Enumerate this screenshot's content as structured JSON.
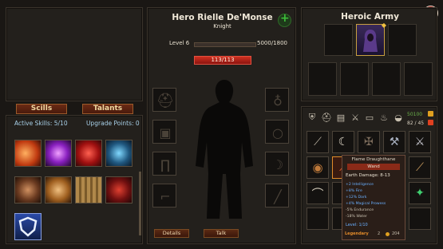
{
  "hero": {
    "name": "Hero Rielle De'Monse",
    "class": "Knight",
    "level_label": "Level 6",
    "xp_text": "5000/1800",
    "hp_text": "113/113"
  },
  "skills_panel": {
    "tab_skills": "Scills",
    "tab_talents": "Talants",
    "active_skills": "Active Skills: 5/10",
    "upgrade_points": "Upgrade Points: 0"
  },
  "center_buttons": {
    "details": "Details",
    "talk": "Talk"
  },
  "army": {
    "title": "Heroic Army"
  },
  "inventory": {
    "gold": "50100",
    "gems": "82 / 45"
  },
  "tooltip": {
    "name": "Flame Draughthane",
    "type": "Wand",
    "damage": "Earth Damage: 8-13",
    "stats": [
      "+2 Intelligence",
      "+8% Fire",
      "+12% Dark",
      "+4% Magical Prowess",
      "-5% Endurance",
      "-18% Water"
    ],
    "level": "Level: 1/10",
    "rarity": "Legendary",
    "count": "2",
    "price": "204"
  },
  "colors": {
    "accent_red": "#b02418",
    "legendary": "#e08a2a",
    "tooltip_blue": "#6ab0ff"
  }
}
